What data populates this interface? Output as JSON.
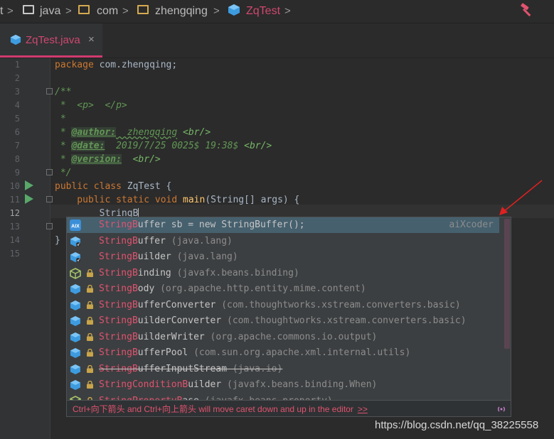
{
  "breadcrumb": {
    "items": [
      "t",
      "java",
      "com",
      "zhengqing",
      "ZqTest"
    ],
    "separator": ">"
  },
  "tab": {
    "label": "ZqTest.java",
    "close": "×"
  },
  "editor": {
    "line_numbers": [
      "1",
      "2",
      "3",
      "4",
      "5",
      "6",
      "7",
      "8",
      "9",
      "10",
      "11",
      "12",
      "13",
      "14",
      "15"
    ],
    "current_line": "12",
    "lines": {
      "l1_kw": "package",
      "l1_rest": " com.zhengqing;",
      "l3": "/**",
      "l4": " *  <p>  </p>",
      "l5": " *",
      "l6_star": " * ",
      "l6_tag": "@author:",
      "l6_val": "  zhengqing",
      "l6_br": " <br/>",
      "l7_star": " * ",
      "l7_tag": "@date:",
      "l7_val": "  2019/7/25 0025$ 19:38$",
      "l7_br": " <br/>",
      "l8_star": " * ",
      "l8_tag": "@version:",
      "l8_br": "  <br/>",
      "l9": " */",
      "l10_kw": "public class",
      "l10_rest": " ZqTest {",
      "l11_kw": "    public static void",
      "l11_fn": " main",
      "l11_rest": "(String[] args) {",
      "l12": "        StringB",
      "l14": "}"
    }
  },
  "completion": {
    "items": [
      {
        "match": "StringB",
        "rest": "uffer sb = new StringBuffer();",
        "pkg": "",
        "source": "aiXcoder",
        "icon": "aix-icon",
        "lock": false,
        "deprecated": false
      },
      {
        "match": "StringB",
        "rest": "uffer",
        "pkg": " (java.lang)",
        "source": "",
        "icon": "class-final-icon",
        "lock": false,
        "deprecated": false
      },
      {
        "match": "StringB",
        "rest": "uilder",
        "pkg": " (java.lang)",
        "source": "",
        "icon": "class-final-icon",
        "lock": false,
        "deprecated": false
      },
      {
        "match": "StringB",
        "rest": "inding",
        "pkg": " (javafx.beans.binding)",
        "source": "",
        "icon": "abstract-class-icon",
        "lock": true,
        "deprecated": false
      },
      {
        "match": "StringB",
        "rest": "ody",
        "pkg": " (org.apache.http.entity.mime.content)",
        "source": "",
        "icon": "class-icon",
        "lock": true,
        "deprecated": false
      },
      {
        "match": "StringB",
        "rest": "ufferConverter",
        "pkg": " (com.thoughtworks.xstream.converters.basic)",
        "source": "",
        "icon": "class-icon",
        "lock": true,
        "deprecated": false
      },
      {
        "match": "StringB",
        "rest": "uilderConverter",
        "pkg": " (com.thoughtworks.xstream.converters.basic)",
        "source": "",
        "icon": "class-icon",
        "lock": true,
        "deprecated": false
      },
      {
        "match": "StringB",
        "rest": "uilderWriter",
        "pkg": " (org.apache.commons.io.output)",
        "source": "",
        "icon": "class-icon",
        "lock": true,
        "deprecated": false
      },
      {
        "match": "StringB",
        "rest": "ufferPool",
        "pkg": " (com.sun.org.apache.xml.internal.utils)",
        "source": "",
        "icon": "class-icon",
        "lock": true,
        "deprecated": false
      },
      {
        "match": "StringB",
        "rest": "ufferInputStream",
        "pkg": " (java.io)",
        "source": "",
        "icon": "class-icon",
        "lock": true,
        "deprecated": true
      },
      {
        "match": "StringConditionB",
        "rest": "uilder",
        "pkg": " (javafx.beans.binding.When)",
        "source": "",
        "icon": "class-icon",
        "lock": true,
        "deprecated": false
      },
      {
        "match": "StringPropertyB",
        "rest": "ase",
        "pkg": " (javafx.beans.property)",
        "source": "",
        "icon": "abstract-class-icon",
        "lock": true,
        "deprecated": false
      }
    ],
    "hint": "Ctrl+向下箭头 and Ctrl+向上箭头 will move caret down and up in the editor",
    "hint_link": ">>"
  },
  "watermark": "https://blog.csdn.net/qq_38225558",
  "colors": {
    "accent": "#d03a6e",
    "keyword": "#cc7832",
    "doc_comment": "#629755",
    "selection": "#46606e",
    "run_icon": "#59a869",
    "class_icon": "#3d9be0",
    "annotation_arrow": "#e02020"
  }
}
